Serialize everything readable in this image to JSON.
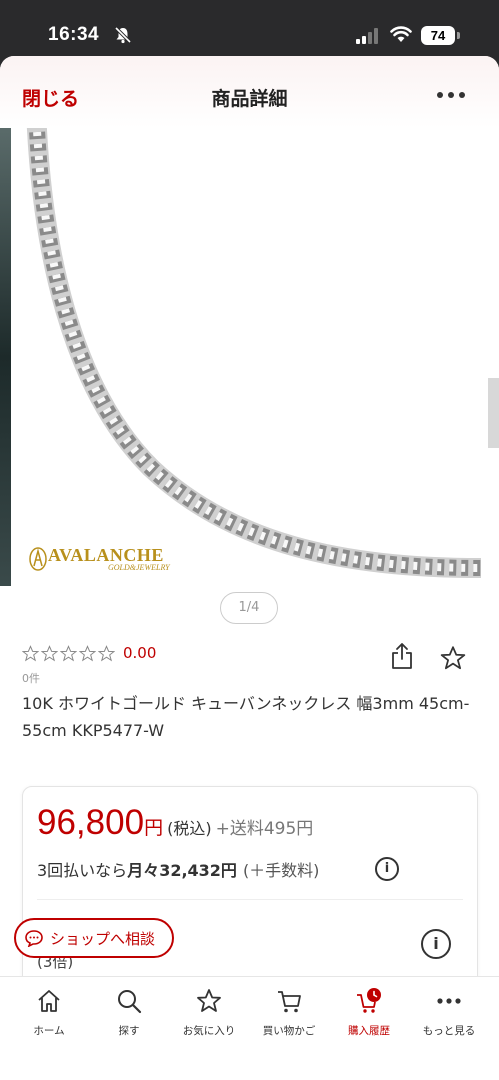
{
  "status_bar": {
    "time": "16:34",
    "battery": "74"
  },
  "header": {
    "close_label": "閉じる",
    "title": "商品詳細"
  },
  "gallery": {
    "pager": "1/4",
    "brand_name": "AVALANCHE",
    "brand_sub": "GOLD&JEWELRY"
  },
  "rating": {
    "value": "0.00",
    "count": "0件",
    "stars": 0
  },
  "product": {
    "title": "10K ホワイトゴールド キューバンネックレス 幅3mm 45cm-55cm KKP5477-W"
  },
  "price": {
    "amount": "96,800",
    "yen": "円",
    "tax": "(税込)",
    "shipping": "+送料495円",
    "installment_prefix": "3回払いなら",
    "installment_amount": "月々32,432円",
    "installment_fee": "(＋手数料)",
    "sub_text": "(3倍)"
  },
  "consult_button": {
    "label": "ショップへ相談"
  },
  "tabs": [
    {
      "label": "ホーム",
      "icon": "home-icon"
    },
    {
      "label": "探す",
      "icon": "search-icon"
    },
    {
      "label": "お気に入り",
      "icon": "star-icon"
    },
    {
      "label": "買い物かご",
      "icon": "cart-icon"
    },
    {
      "label": "購入履歴",
      "icon": "history-icon"
    },
    {
      "label": "もっと見る",
      "icon": "more-icon"
    }
  ],
  "colors": {
    "accent": "#bf0000",
    "brand_gold": "#b8901c"
  }
}
